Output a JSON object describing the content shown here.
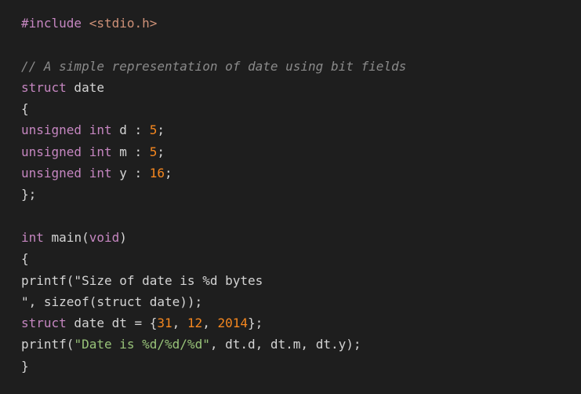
{
  "editor": {
    "language": "c",
    "colors": {
      "background": "#1e1e1e",
      "plain": "#d4d4d4",
      "keyword": "#c586c0",
      "comment": "#8a8a8a",
      "number": "#f5871f",
      "string": "#98c379",
      "include_header": "#ce9178"
    },
    "lines": [
      [
        {
          "t": "#include",
          "k": "directive"
        },
        {
          "t": " ",
          "k": "plain"
        },
        {
          "t": "<stdio.h>",
          "k": "include"
        }
      ],
      [],
      [
        {
          "t": "// A simple representation of date using bit fields",
          "k": "comment"
        }
      ],
      [
        {
          "t": "struct",
          "k": "keyword"
        },
        {
          "t": " date",
          "k": "plain"
        }
      ],
      [
        {
          "t": "{",
          "k": "plain"
        }
      ],
      [
        {
          "t": "unsigned",
          "k": "keyword"
        },
        {
          "t": " ",
          "k": "plain"
        },
        {
          "t": "int",
          "k": "keyword"
        },
        {
          "t": " d : ",
          "k": "plain"
        },
        {
          "t": "5",
          "k": "number"
        },
        {
          "t": ";",
          "k": "plain"
        }
      ],
      [
        {
          "t": "unsigned",
          "k": "keyword"
        },
        {
          "t": " ",
          "k": "plain"
        },
        {
          "t": "int",
          "k": "keyword"
        },
        {
          "t": " m : ",
          "k": "plain"
        },
        {
          "t": "5",
          "k": "number"
        },
        {
          "t": ";",
          "k": "plain"
        }
      ],
      [
        {
          "t": "unsigned",
          "k": "keyword"
        },
        {
          "t": " ",
          "k": "plain"
        },
        {
          "t": "int",
          "k": "keyword"
        },
        {
          "t": " y : ",
          "k": "plain"
        },
        {
          "t": "16",
          "k": "number"
        },
        {
          "t": ";",
          "k": "plain"
        }
      ],
      [
        {
          "t": "};",
          "k": "plain"
        }
      ],
      [],
      [
        {
          "t": "int",
          "k": "keyword"
        },
        {
          "t": " main(",
          "k": "plain"
        },
        {
          "t": "void",
          "k": "keyword"
        },
        {
          "t": ")",
          "k": "plain"
        }
      ],
      [
        {
          "t": "{",
          "k": "plain"
        }
      ],
      [
        {
          "t": "printf(\"Size of date is %d bytes",
          "k": "plain"
        }
      ],
      [
        {
          "t": "\", sizeof(struct date));",
          "k": "plain"
        }
      ],
      [
        {
          "t": "struct",
          "k": "keyword"
        },
        {
          "t": " date dt = {",
          "k": "plain"
        },
        {
          "t": "31",
          "k": "number"
        },
        {
          "t": ", ",
          "k": "plain"
        },
        {
          "t": "12",
          "k": "number"
        },
        {
          "t": ", ",
          "k": "plain"
        },
        {
          "t": "2014",
          "k": "number"
        },
        {
          "t": "};",
          "k": "plain"
        }
      ],
      [
        {
          "t": "printf(",
          "k": "plain"
        },
        {
          "t": "\"Date is %d/%d/%d\"",
          "k": "string"
        },
        {
          "t": ", dt.d, dt.m, dt.y);",
          "k": "plain"
        }
      ],
      [
        {
          "t": "}",
          "k": "plain"
        }
      ]
    ]
  }
}
